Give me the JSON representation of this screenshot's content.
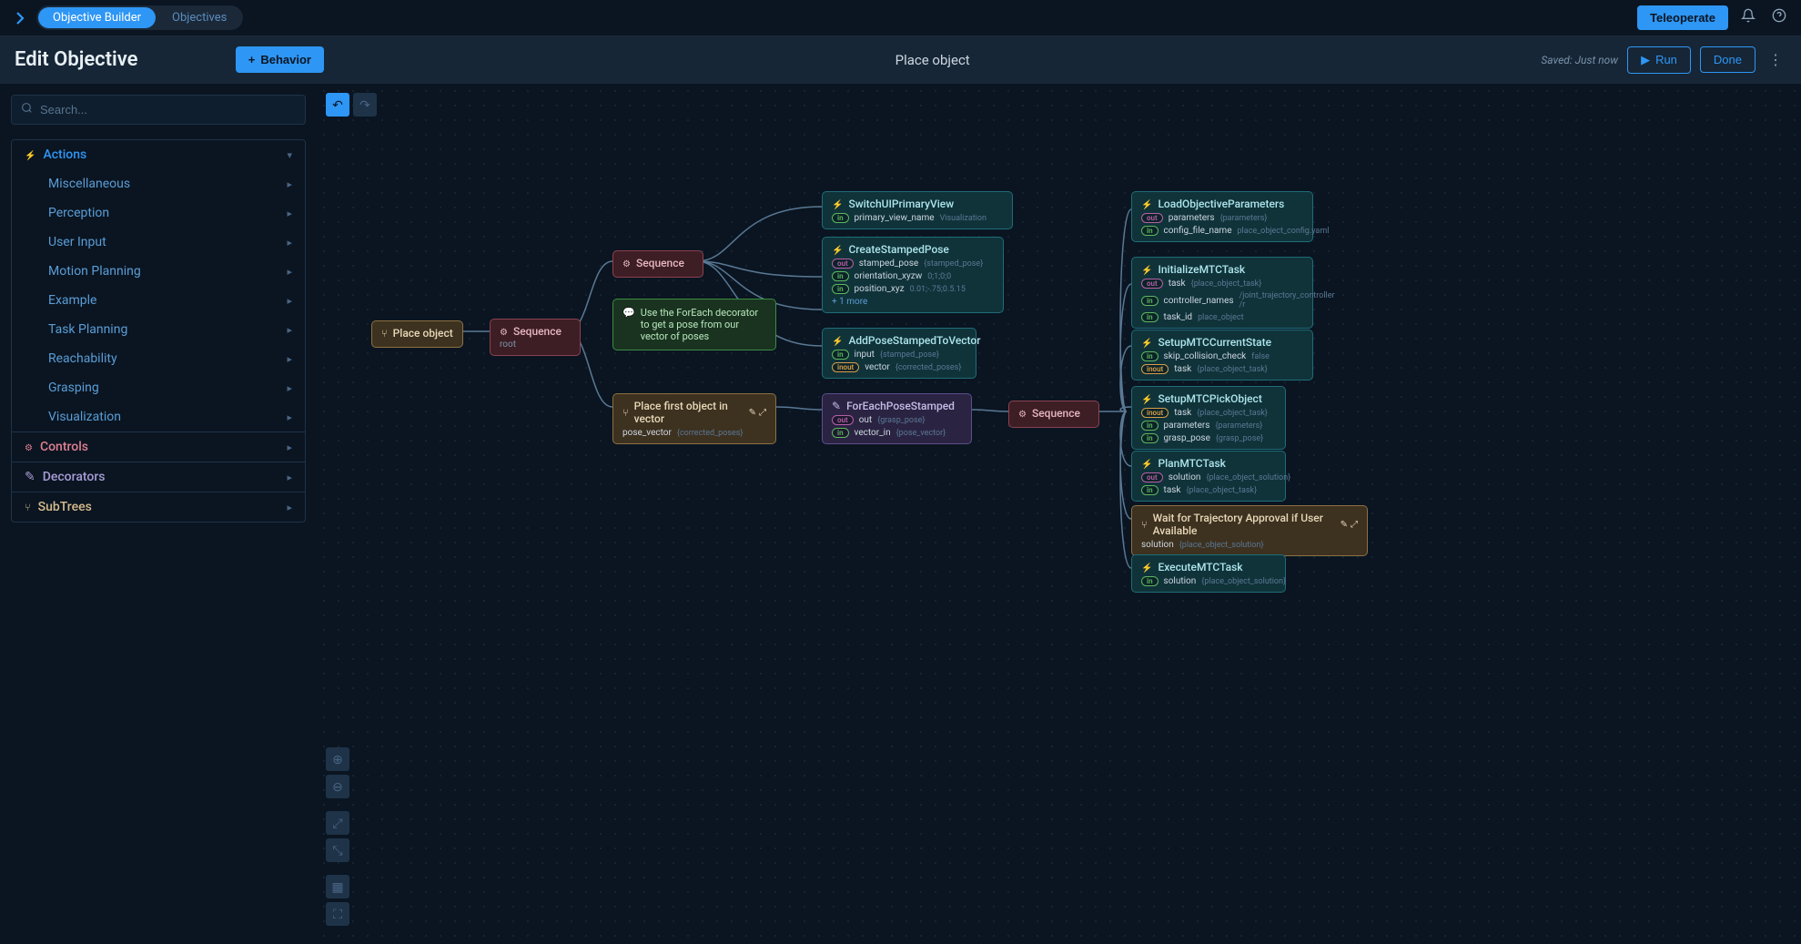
{
  "topbar": {
    "tabs": [
      "Objective Builder",
      "Objectives"
    ],
    "teleoperate": "Teleoperate"
  },
  "header": {
    "title": "Edit Objective",
    "behavior_btn": "Behavior",
    "objective_name": "Place object",
    "saved": "Saved: Just now",
    "run": "Run",
    "done": "Done"
  },
  "search": {
    "placeholder": "Search..."
  },
  "tree": {
    "actions": "Actions",
    "actions_subs": [
      "Miscellaneous",
      "Perception",
      "User Input",
      "Motion Planning",
      "Example",
      "Task Planning",
      "Reachability",
      "Grasping",
      "Visualization"
    ],
    "controls": "Controls",
    "decorators": "Decorators",
    "subtrees": "SubTrees"
  },
  "nodes": {
    "root": "Place object",
    "seq_root": "Sequence",
    "seq_root_sub": "root",
    "seq_child": "Sequence",
    "comment": "Use the ForEach decorator to get a pose from our vector of poses",
    "switch_ui": {
      "title": "SwitchUIPrimaryView",
      "p1_name": "primary_view_name",
      "p1_val": "Visualization"
    },
    "create_pose": {
      "title": "CreateStampedPose",
      "p1_name": "stamped_pose",
      "p1_val": "stamped_pose",
      "p2_name": "orientation_xyzw",
      "p2_val": "0;1;0;0",
      "p3_name": "position_xyz",
      "p3_val": "0.01;-.75;0.5.15",
      "more": "+ 1 more"
    },
    "add_pose": {
      "title": "AddPoseStampedToVector",
      "p1_name": "input",
      "p1_val": "stamped_pose",
      "p2_name": "vector",
      "p2_val": "corrected_poses"
    },
    "place_sub": {
      "title": "Place first object in vector",
      "p1_name": "pose_vector",
      "p1_val": "corrected_poses"
    },
    "foreach": {
      "title": "ForEachPoseStamped",
      "p1_name": "out",
      "p1_val": "grasp_pose",
      "p2_name": "vector_in",
      "p2_val": "pose_vector"
    },
    "seq3": "Sequence",
    "load_params": {
      "title": "LoadObjectiveParameters",
      "p1_name": "parameters",
      "p1_val": "parameters",
      "p2_name": "config_file_name",
      "p2_val": "place_object_config.yaml"
    },
    "init_mtc": {
      "title": "InitializeMTCTask",
      "p1_name": "task",
      "p1_val": "place_object_task",
      "p2_name": "controller_names",
      "p2_val": "/joint_trajectory_controller /r",
      "p3_name": "task_id",
      "p3_val": "place_object"
    },
    "setup_state": {
      "title": "SetupMTCCurrentState",
      "p1_name": "skip_collision_check",
      "p1_val": "false",
      "p2_name": "task",
      "p2_val": "place_object_task"
    },
    "setup_pick": {
      "title": "SetupMTCPickObject",
      "p1_name": "task",
      "p1_val": "place_object_task",
      "p2_name": "parameters",
      "p2_val": "parameters",
      "p3_name": "grasp_pose",
      "p3_val": "grasp_pose"
    },
    "plan_mtc": {
      "title": "PlanMTCTask",
      "p1_name": "solution",
      "p1_val": "place_object_solution",
      "p2_name": "task",
      "p2_val": "place_object_task"
    },
    "wait_traj": {
      "title": "Wait for Trajectory Approval if User Available",
      "p1_name": "solution",
      "p1_val": "place_object_solution"
    },
    "execute_mtc": {
      "title": "ExecuteMTCTask",
      "p1_name": "solution",
      "p1_val": "place_object_solution"
    }
  }
}
